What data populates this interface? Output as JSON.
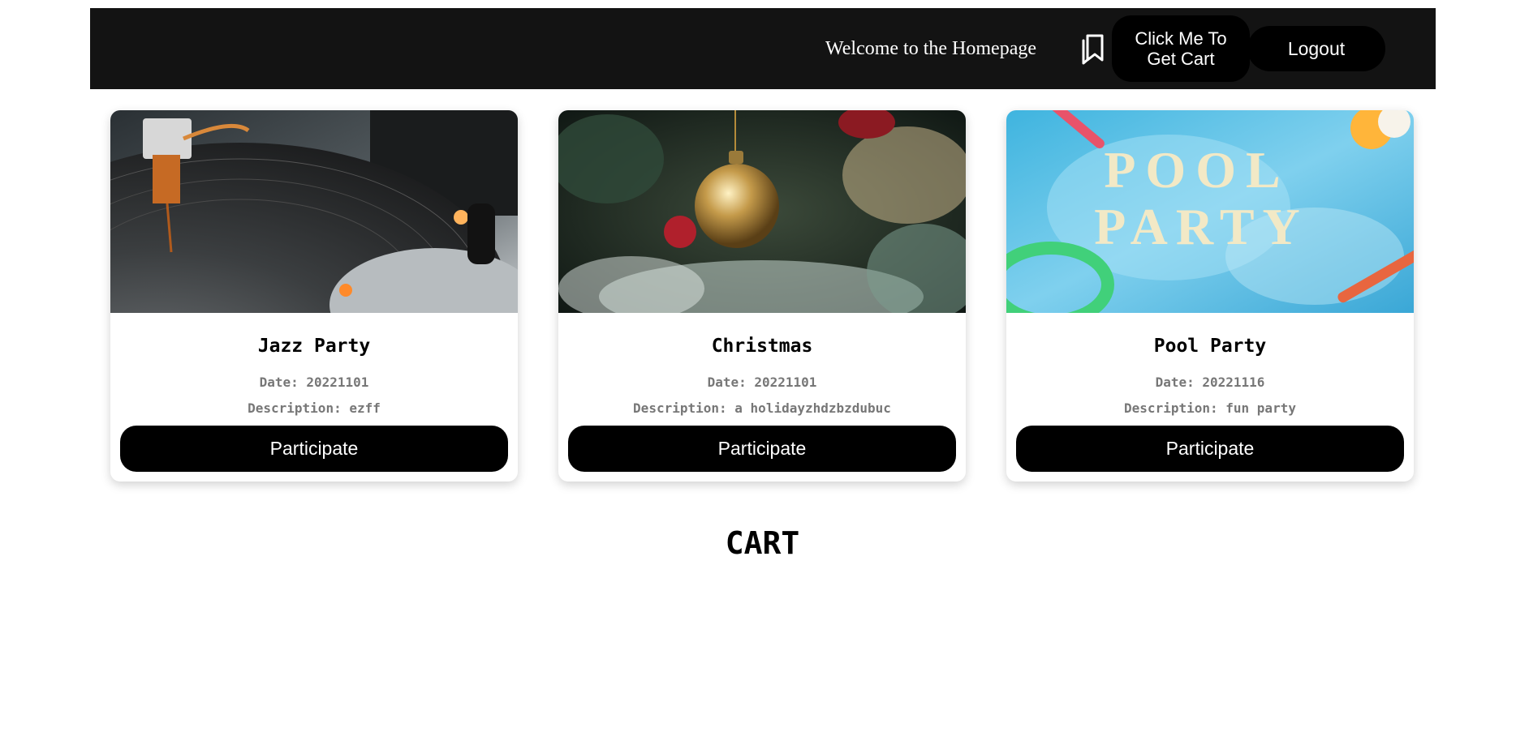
{
  "header": {
    "welcome_text": "Welcome to the Homepage",
    "cart_button_label": "Click Me To Get Cart",
    "logout_button_label": "Logout"
  },
  "events": [
    {
      "title": "Jazz Party",
      "date_label": "Date:",
      "date": "20221101",
      "description_label": "Description:",
      "description": "ezff",
      "button_label": "Participate",
      "image_icon": "turntable-photo"
    },
    {
      "title": "Christmas",
      "date_label": "Date:",
      "date": "20221101",
      "description_label": "Description:",
      "description": "a holidayzhdzbzdubuc",
      "button_label": "Participate",
      "image_icon": "christmas-ornament-photo"
    },
    {
      "title": "Pool Party",
      "date_label": "Date:",
      "date": "20221116",
      "description_label": "Description:",
      "description": "fun party",
      "button_label": "Participate",
      "image_icon": "pool-party-photo",
      "image_text": "POOL PARTY"
    }
  ],
  "cart": {
    "heading": "CART"
  },
  "colors": {
    "navbar": "#131313",
    "button": "#000000",
    "muted_text": "#777777"
  }
}
